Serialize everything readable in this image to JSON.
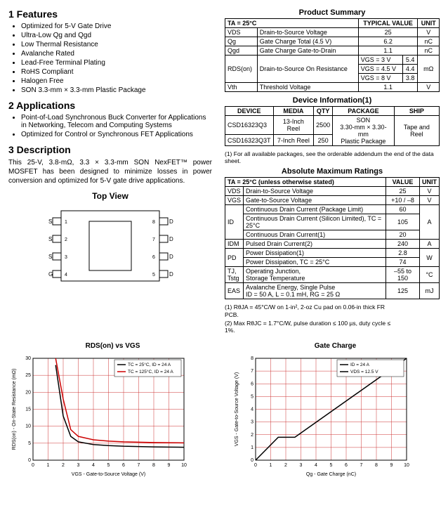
{
  "sections": {
    "features_heading": "1  Features",
    "features": [
      "Optimized for 5-V Gate Drive",
      "Ultra-Low Qg and Qgd",
      "Low Thermal Resistance",
      "Avalanche Rated",
      "Lead-Free Terminal Plating",
      "RoHS Compliant",
      "Halogen Free",
      "SON 3.3-mm × 3.3-mm Plastic Package"
    ],
    "apps_heading": "2  Applications",
    "apps": [
      "Point-of-Load Synchronous Buck Converter for Applications in Networking, Telecom and Computing Systems",
      "Optimized for Control or Synchronous FET Applications"
    ],
    "desc_heading": "3  Description",
    "desc_text": "This 25-V, 3.8-mΩ, 3.3 × 3.3-mm SON NexFET™ power MOSFET has been designed to minimize losses in power conversion and optimized for 5-V gate drive applications.",
    "topview_label": "Top View"
  },
  "product_summary": {
    "title": "Product Summary",
    "cond": "TA = 25°C",
    "col_typ": "TYPICAL VALUE",
    "col_unit": "UNIT",
    "rows": [
      {
        "sym": "VDS",
        "param": "Drain-to-Source Voltage",
        "val": "25",
        "unit": "V"
      },
      {
        "sym": "Qg",
        "param": "Gate Charge Total (4.5 V)",
        "val": "6.2",
        "unit": "nC"
      },
      {
        "sym": "Qgd",
        "param": "Gate Charge Gate-to-Drain",
        "val": "1.1",
        "unit": "nC"
      }
    ],
    "rdson": {
      "sym": "RDS(on)",
      "param": "Drain-to-Source On Resistance",
      "conds": [
        {
          "c": "VGS = 3 V",
          "v": "5.4"
        },
        {
          "c": "VGS = 4.5 V",
          "v": "4.4"
        },
        {
          "c": "VGS = 8 V",
          "v": "3.8"
        }
      ],
      "unit": "mΩ"
    },
    "vth": {
      "sym": "Vth",
      "param": "Threshold Voltage",
      "val": "1.1",
      "unit": "V"
    }
  },
  "device_info": {
    "title": "Device Information(1)",
    "head": {
      "dev": "DEVICE",
      "media": "MEDIA",
      "qty": "QTY",
      "pkg": "PACKAGE",
      "ship": "SHIP"
    },
    "rows": [
      {
        "dev": "CSD16323Q3",
        "media": "13-Inch Reel",
        "qty": "2500"
      },
      {
        "dev": "CSD16323Q3T",
        "media": "7-Inch Reel",
        "qty": "250"
      }
    ],
    "pkg": "SON\n3.30-mm × 3.30-mm\nPlastic Package",
    "ship": "Tape and Reel",
    "note": "(1) For all available packages, see the orderable addendum the end of the data sheet."
  },
  "abs_max": {
    "title": "Absolute Maximum Ratings",
    "cond": "TA = 25°C (unless otherwise stated)",
    "col_val": "VALUE",
    "col_unit": "UNIT",
    "rows": [
      {
        "sym": "VDS",
        "param": "Drain-to-Source Voltage",
        "val": "25",
        "unit": "V"
      },
      {
        "sym": "VGS",
        "param": "Gate-to-Source Voltage",
        "val": "+10 / –8",
        "unit": "V"
      }
    ],
    "id": {
      "sym": "ID",
      "rows": [
        {
          "param": "Continuous Drain Current (Package Limit)",
          "val": "60"
        },
        {
          "param": "Continuous Drain Current (Silicon Limited), TC = 25°C",
          "val": "105"
        },
        {
          "param": "Continuous Drain Current(1)",
          "val": "20"
        }
      ],
      "unit": "A"
    },
    "idm": {
      "sym": "IDM",
      "param": "Pulsed Drain Current(2)",
      "val": "240",
      "unit": "A"
    },
    "pd": {
      "sym": "PD",
      "rows": [
        {
          "param": "Power Dissipation(1)",
          "val": "2.8"
        },
        {
          "param": "Power Dissipation, TC = 25°C",
          "val": "74"
        }
      ],
      "unit": "W"
    },
    "tj": {
      "sym": "TJ,\nTstg",
      "param": "Operating Junction,\nStorage Temperature",
      "val": "–55 to 150",
      "unit": "°C"
    },
    "eas": {
      "sym": "EAS",
      "param": "Avalanche Energy, Single Pulse\nID = 50 A, L = 0.1 mH, RG = 25 Ω",
      "val": "125",
      "unit": "mJ"
    },
    "note1": "(1) RθJA = 45°C/W on 1-in², 2-oz Cu pad on 0.06-in thick FR\n       PCB.",
    "note2": "(2) Max RθJC = 1.7°C/W, pulse duration ≤ 100 µs, duty cycle ≤\n       1%."
  },
  "chart_data": [
    {
      "type": "line",
      "title": "RDS(on) vs VGS",
      "xlabel": "VGS - Gate-to-Source Voltage (V)",
      "ylabel": "RDS(on) - On-State Resistance (mΩ)",
      "xlim": [
        0,
        10
      ],
      "ylim": [
        0,
        30
      ],
      "x": [
        1.5,
        2,
        2.5,
        3,
        4,
        5,
        6,
        7,
        8,
        9,
        10
      ],
      "series": [
        {
          "name": "TC = 25°C, ID = 24 A",
          "color": "#000",
          "values": [
            28,
            13,
            7,
            5.4,
            4.6,
            4.3,
            4.1,
            4.0,
            3.9,
            3.85,
            3.8
          ]
        },
        {
          "name": "TC = 125°C, ID = 24 A",
          "color": "#c00",
          "values": [
            30,
            18,
            9,
            7,
            6,
            5.6,
            5.4,
            5.3,
            5.2,
            5.15,
            5.1
          ]
        }
      ]
    },
    {
      "type": "line",
      "title": "Gate Charge",
      "xlabel": "Qg - Gate Charge (nC)",
      "ylabel": "VGS - Gate-to-Source Voltage (V)",
      "xlim": [
        0,
        10
      ],
      "ylim": [
        0,
        8
      ],
      "legend": [
        "ID = 24 A",
        "VDS = 12.5 V"
      ],
      "x": [
        0,
        1.5,
        2.6,
        10
      ],
      "series": [
        {
          "name": "Gate Charge",
          "color": "#000",
          "values": [
            0,
            1.8,
            1.8,
            8
          ]
        }
      ]
    }
  ]
}
